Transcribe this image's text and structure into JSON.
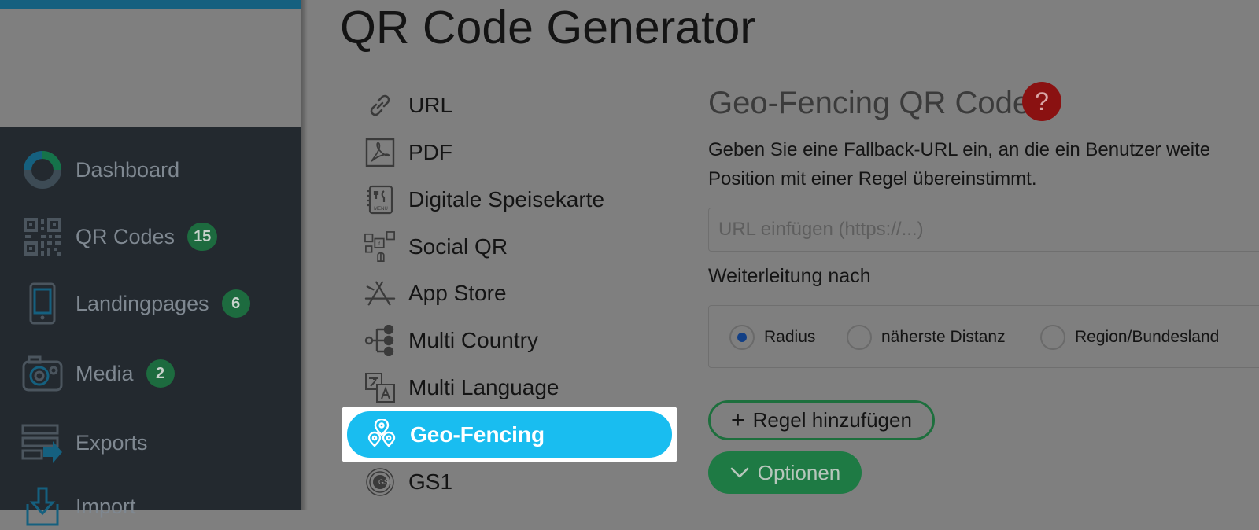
{
  "app": {
    "title": "QR Code Generator"
  },
  "sidebar": {
    "items": [
      {
        "label": "Dashboard",
        "icon": "dashboard-donut-icon"
      },
      {
        "label": "QR Codes",
        "badge": "15",
        "icon": "qr-code-icon"
      },
      {
        "label": "Landingpages",
        "badge": "6",
        "icon": "phone-icon"
      },
      {
        "label": "Media",
        "badge": "2",
        "icon": "camera-icon"
      },
      {
        "label": "Exports",
        "icon": "export-icon"
      },
      {
        "label": "Import",
        "icon": "import-icon"
      }
    ]
  },
  "types": {
    "items": [
      {
        "label": "URL",
        "icon": "link-icon"
      },
      {
        "label": "PDF",
        "icon": "pdf-icon"
      },
      {
        "label": "Digitale Speisekarte",
        "icon": "menu-icon"
      },
      {
        "label": "Social QR",
        "icon": "social-icon"
      },
      {
        "label": "App Store",
        "icon": "app-store-icon"
      },
      {
        "label": "Multi Country",
        "icon": "multi-country-icon"
      },
      {
        "label": "Multi Language",
        "icon": "multi-language-icon"
      },
      {
        "label": "Geo-Fencing",
        "icon": "geo-fencing-icon",
        "selected": true
      },
      {
        "label": "GS1",
        "icon": "gs1-icon"
      }
    ]
  },
  "form": {
    "title": "Geo-Fencing QR Code",
    "help_label": "?",
    "description_line1": "Geben Sie eine Fallback-URL ein, an die ein Benutzer weite",
    "description_line2": "Position mit einer Regel übereinstimmt.",
    "url_placeholder": "URL einfügen (https://...)",
    "url_value": "",
    "redirect_label": "Weiterleitung nach",
    "radio_options": [
      {
        "label": "Radius",
        "checked": true
      },
      {
        "label": "näherste Distanz",
        "checked": false
      },
      {
        "label": "Region/Bundesland",
        "checked": false
      }
    ],
    "add_rule_label": "Regel hinzufügen",
    "add_rule_icon": "plus-icon",
    "options_label": "Optionen",
    "options_icon": "chevron-down-icon"
  },
  "colors": {
    "overlay_gray": "#7f7f7f",
    "sidebar_bg": "#23292f",
    "selected_blue": "#19bdf0",
    "badge_green": "#1d6b3f",
    "help_red": "#8a1111",
    "options_green": "#1e7a44",
    "radio_blue": "#123f85"
  }
}
